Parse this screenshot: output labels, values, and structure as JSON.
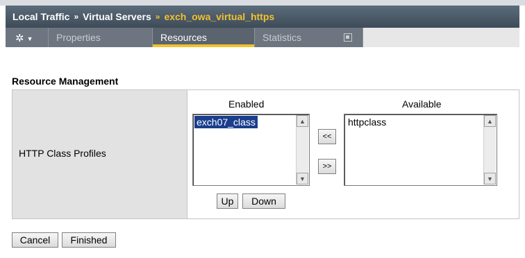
{
  "breadcrumb": {
    "items": [
      "Local Traffic",
      "Virtual Servers"
    ],
    "separator": "»",
    "current": "exch_owa_virtual_https"
  },
  "tabs": {
    "gear_icon": "gear-icon",
    "properties": "Properties",
    "resources": "Resources",
    "statistics": "Statistics",
    "active": "Resources"
  },
  "section": {
    "title": "Resource Management"
  },
  "row": {
    "label": "HTTP Class Profiles"
  },
  "enabled": {
    "header": "Enabled",
    "items": [
      "exch07_class"
    ],
    "selected": "exch07_class"
  },
  "available": {
    "header": "Available",
    "items": [
      "httpclass"
    ]
  },
  "move_buttons": {
    "to_enabled": "<<",
    "to_available": ">>"
  },
  "order_buttons": {
    "up": "Up",
    "down": "Down"
  },
  "footer": {
    "cancel": "Cancel",
    "finished": "Finished"
  },
  "colors": {
    "accent": "#f2c12e",
    "selection": "#1a3e8c",
    "header": "#4b5a67"
  }
}
